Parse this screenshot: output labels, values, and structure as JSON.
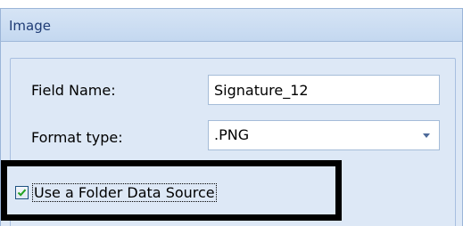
{
  "panel": {
    "title": "Image"
  },
  "fields": {
    "field_name_label": "Field Name:",
    "field_name_value": "Signature_12",
    "format_type_label": "Format type:",
    "format_type_value": ".PNG"
  },
  "options": {
    "use_folder_label": "Use a Folder Data Source",
    "use_folder_checked": true
  },
  "colors": {
    "header_bg": "#c4d8f0",
    "panel_bg": "#dde8f6",
    "title_text": "#1f3c75",
    "highlight_border": "#000000"
  }
}
